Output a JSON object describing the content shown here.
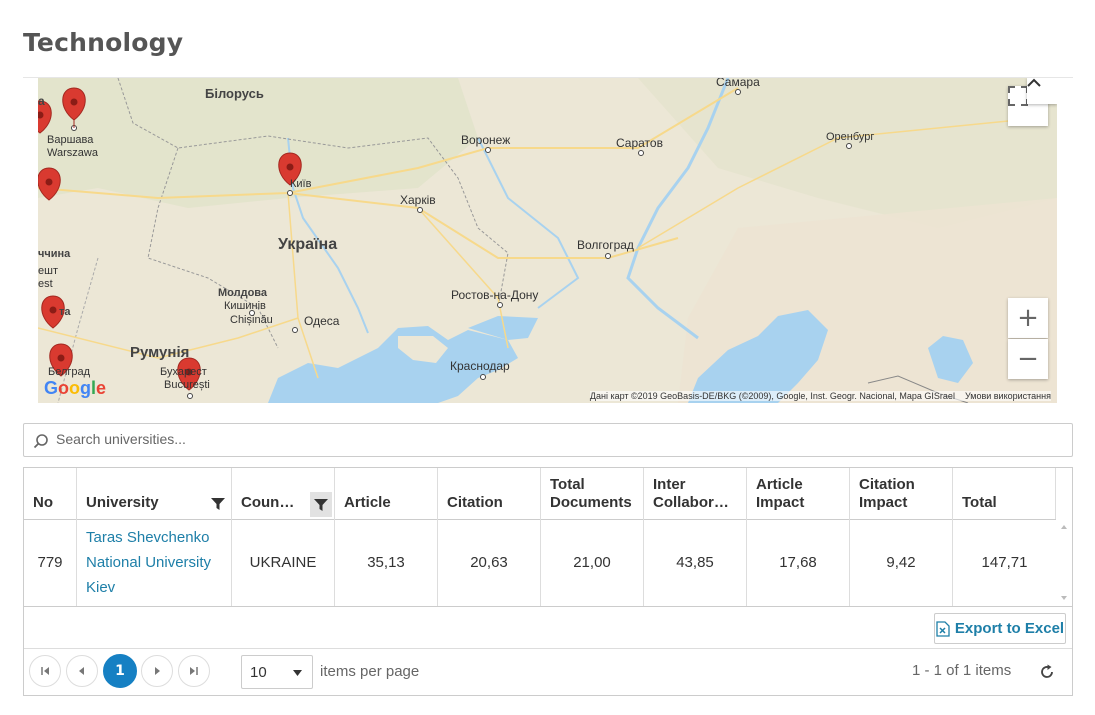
{
  "page": {
    "title": "Technology"
  },
  "map": {
    "labels": {
      "belarus": "Білорусь",
      "warsaw1": "Варшава",
      "warsaw2": "Warszawa",
      "voronezh": "Воронеж",
      "saratov": "Саратов",
      "samara": "Самара",
      "orenburg": "Оренбург",
      "kyiv": "Київ",
      "kharkiv": "Харків",
      "ukraine": "Україна",
      "volgograd": "Волгоград",
      "rostov": "Ростов-на-Дону",
      "moldova": "Молдова",
      "kishinev1": "Кишинів",
      "kishinev2": "Chișinău",
      "odesa": "Одеса",
      "romania": "Румунія",
      "bucharest1": "Бухарест",
      "bucharest2": "București",
      "krasnodar": "Краснодар",
      "belgrade": "Белград",
      "frag_a": "а",
      "frag_chchyna": "ччина",
      "frag_desht": "ешт",
      "frag_est": "est",
      "frag_ta": "та"
    },
    "attribution": "Дані карт ©2019 GeoBasis-DE/BKG (©2009), Google, Inst. Geogr. Nacional, Mapa GISrael",
    "terms": "Умови використання",
    "google_logo": "Google",
    "zoom_in": "+",
    "zoom_out": "−"
  },
  "search": {
    "placeholder": "Search universities..."
  },
  "table": {
    "columns": [
      "No",
      "University",
      "Coun…",
      "Article",
      "Citation",
      "Total Documents",
      "Inter Collabor…",
      "Article Impact",
      "Citation Impact",
      "Total"
    ],
    "col_no": "No",
    "col_university": "University",
    "col_country": "Coun…",
    "col_article": "Article",
    "col_citation": "Citation",
    "col_total_docs_1": "Total",
    "col_total_docs_2": "Documents",
    "col_inter_1": "Inter",
    "col_inter_2": "Collabor…",
    "col_art_imp_1": "Article",
    "col_art_imp_2": "Impact",
    "col_cit_imp_1": "Citation",
    "col_cit_imp_2": "Impact",
    "col_total": "Total",
    "rows": [
      {
        "no": "779",
        "university_1": "Taras Shevchenko",
        "university_2": "National University",
        "university_3": "Kiev",
        "country": "UKRAINE",
        "article": "35,13",
        "citation": "20,63",
        "total_documents": "21,00",
        "inter_collaboration": "43,85",
        "article_impact": "17,68",
        "citation_impact": "9,42",
        "total": "147,71"
      }
    ]
  },
  "export_label": "Export to Excel",
  "pager": {
    "current_page": "1",
    "page_size": "10",
    "items_per_page_label": "items per page",
    "info": "1 - 1 of 1 items"
  },
  "colors": {
    "accent": "#1680c3",
    "link": "#1e7fa8",
    "marker": "#d93a30",
    "water": "#a8d2ef"
  }
}
